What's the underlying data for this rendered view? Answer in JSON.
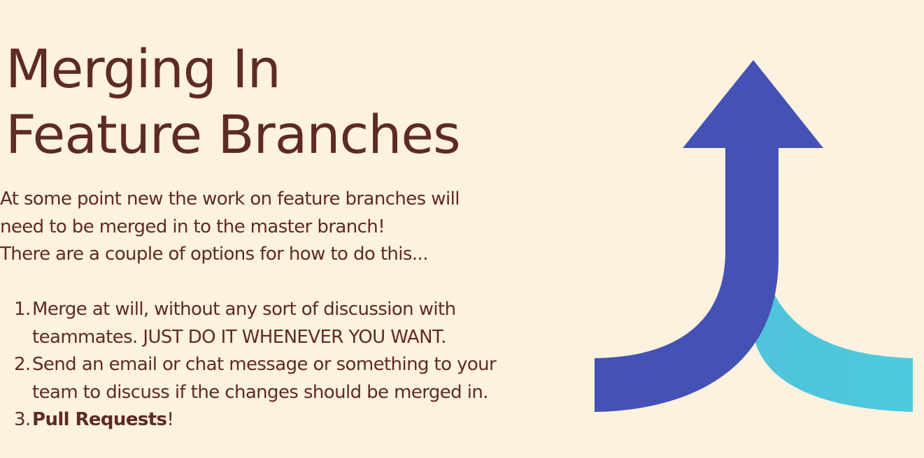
{
  "slide": {
    "title_lines": [
      "Merging In",
      "Feature Branches"
    ],
    "intro_lines": [
      "At some point new the work on feature branches will",
      "need to be merged in to the master branch!",
      "There are a couple of options for how to do this..."
    ],
    "options": [
      {
        "number": "1.",
        "lines": [
          "Merge at will, without any sort of discussion with",
          "teammates.  JUST DO IT WHENEVER YOU WANT."
        ]
      },
      {
        "number": "2.",
        "lines": [
          "Send an email or chat message or something to your",
          "team to discuss if the changes should be merged in."
        ]
      },
      {
        "number": "3.",
        "bold_text": "Pull Requests",
        "suffix": "!"
      }
    ],
    "colors": {
      "background": "#fdf1df",
      "text": "#5e2a26",
      "arrow_main": "#4452b6",
      "arrow_branch": "#4ec6da"
    },
    "graphic": {
      "icon": "merge-arrow-icon"
    }
  }
}
